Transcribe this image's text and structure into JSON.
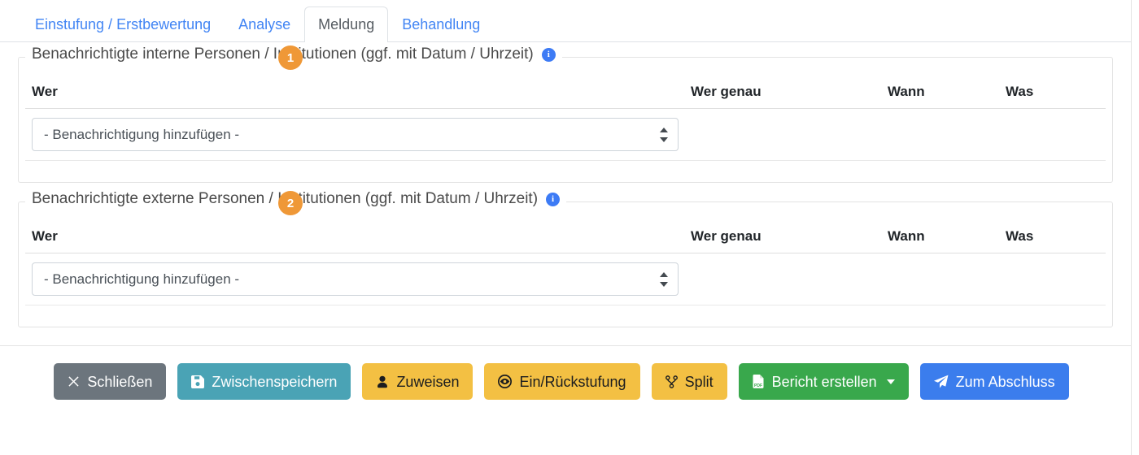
{
  "tabs": [
    {
      "label": "Einstufung / Erstbewertung",
      "active": false
    },
    {
      "label": "Analyse",
      "active": false
    },
    {
      "label": "Meldung",
      "active": true
    },
    {
      "label": "Behandlung",
      "active": false
    }
  ],
  "badges": [
    {
      "id": 1,
      "label": "1"
    },
    {
      "id": 2,
      "label": "2"
    }
  ],
  "sections": [
    {
      "legend": "Benachrichtigte interne Personen / Institutionen (ggf. mit Datum / Uhrzeit)",
      "info_icon": "info-icon",
      "columns": [
        "Wer",
        "Wer genau",
        "Wann",
        "Was"
      ],
      "select_value": "- Benachrichtigung hinzufügen -",
      "cells": [
        "",
        "",
        ""
      ]
    },
    {
      "legend": "Benachrichtigte externe Personen / Institutionen (ggf. mit Datum / Uhrzeit)",
      "info_icon": "info-icon",
      "columns": [
        "Wer",
        "Wer genau",
        "Wann",
        "Was"
      ],
      "select_value": "- Benachrichtigung hinzufügen -",
      "cells": [
        "",
        "",
        ""
      ]
    }
  ],
  "footer": {
    "buttons": [
      {
        "label": "Schließen",
        "icon": "close-icon",
        "style": "btn-secondary"
      },
      {
        "label": "Zwischenspeichern",
        "icon": "save-icon",
        "style": "btn-teal"
      },
      {
        "label": "Zuweisen",
        "icon": "user-icon",
        "style": "btn-warning"
      },
      {
        "label": "Ein/Rückstufung",
        "icon": "eye-icon",
        "style": "btn-warning"
      },
      {
        "label": "Split",
        "icon": "code-branch-icon",
        "style": "btn-warning"
      },
      {
        "label": "Bericht erstellen",
        "icon": "pdf-file-icon",
        "style": "btn-success",
        "caret": true
      },
      {
        "label": "Zum Abschluss",
        "icon": "paper-plane-icon",
        "style": "btn-primary"
      }
    ]
  },
  "colors": {
    "tab_link": "#4285f4",
    "badge": "#ef9837",
    "info": "#3d7bf5",
    "secondary": "#6c757d",
    "teal": "#4aa3b5",
    "warning": "#f3c043",
    "success": "#39a84c",
    "primary": "#3b7ded"
  }
}
